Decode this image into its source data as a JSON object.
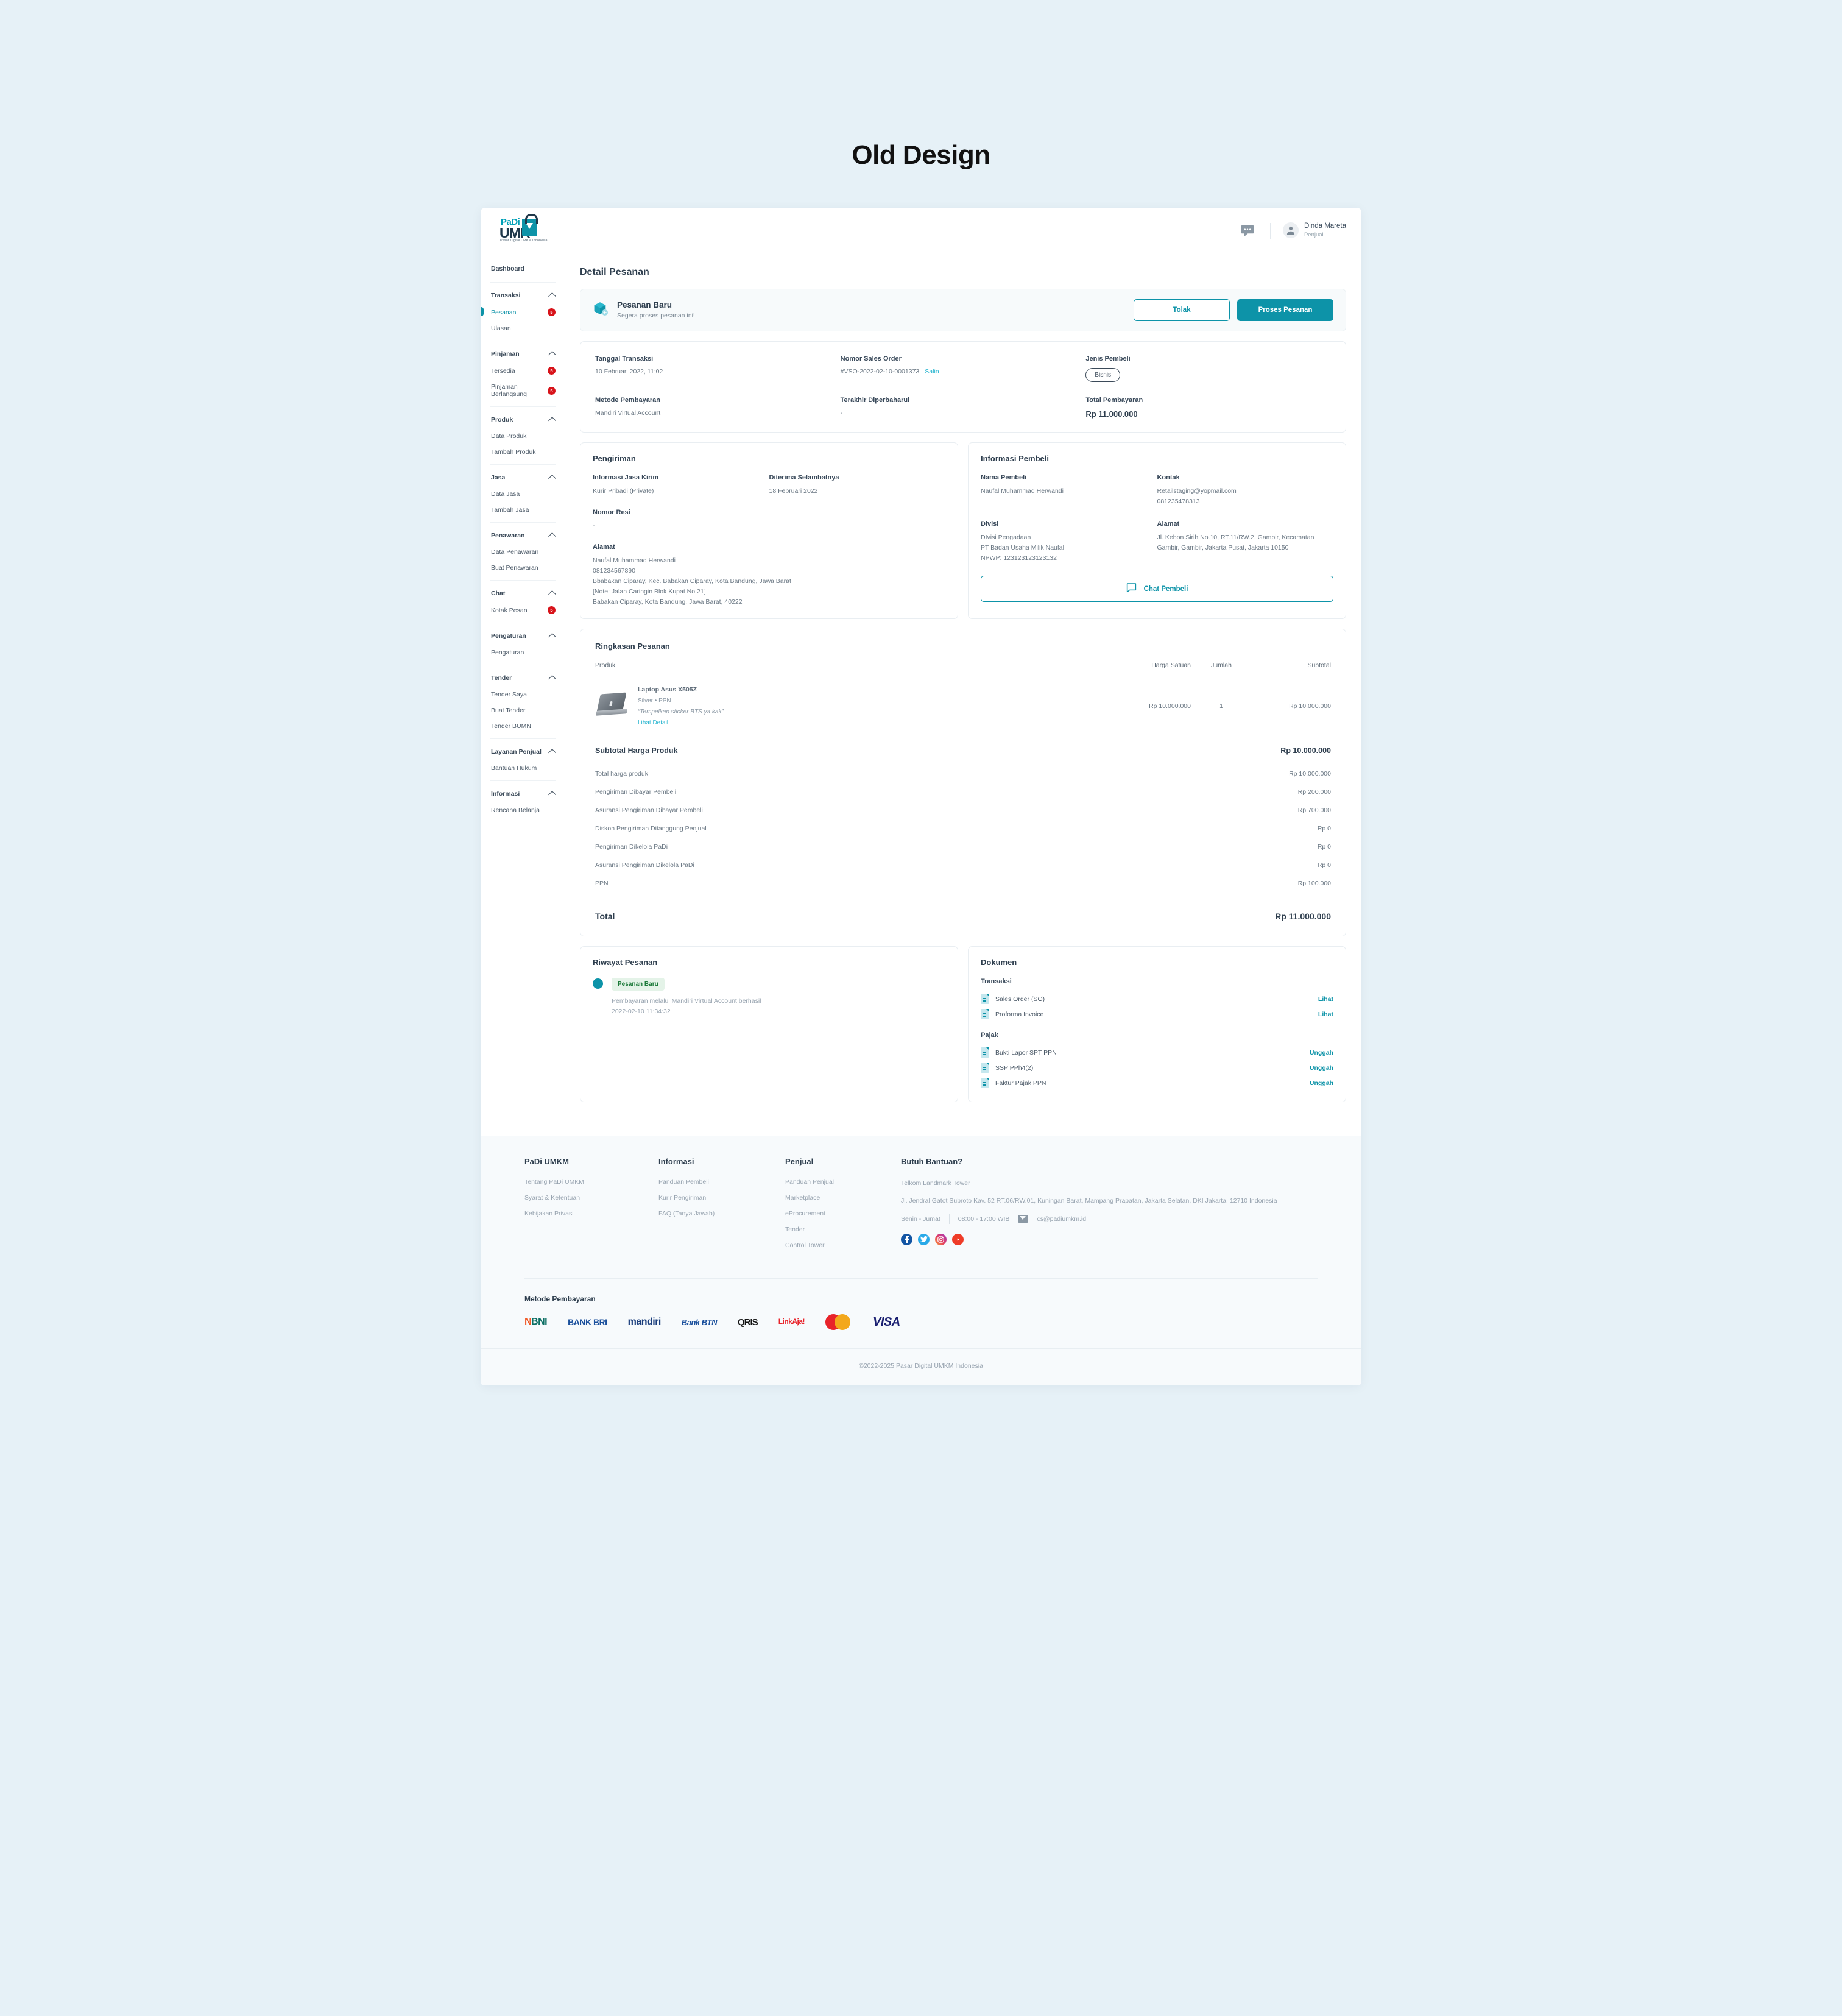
{
  "page": {
    "title": "Old Design"
  },
  "topbar": {
    "logo": {
      "padi": "PaDi",
      "umk": "UMK",
      "tagline": "Pasar Digital UMKM Indonesia"
    },
    "user": {
      "name": "Dinda Mareta",
      "role": "Penjual"
    }
  },
  "sidebar": {
    "dashboard": "Dashboard",
    "groups": [
      {
        "label": "Transaksi",
        "items": [
          {
            "label": "Pesanan",
            "badge": "5",
            "active": true
          },
          {
            "label": "Ulasan",
            "badge": "",
            "active": false
          }
        ]
      },
      {
        "label": "Pinjaman",
        "items": [
          {
            "label": "Tersedia",
            "badge": "5",
            "active": false
          },
          {
            "label": "Pinjaman Berlangsung",
            "badge": "5",
            "active": false
          }
        ]
      },
      {
        "label": "Produk",
        "items": [
          {
            "label": "Data Produk",
            "badge": "",
            "active": false
          },
          {
            "label": "Tambah Produk",
            "badge": "",
            "active": false
          }
        ]
      },
      {
        "label": "Jasa",
        "items": [
          {
            "label": "Data Jasa",
            "badge": "",
            "active": false
          },
          {
            "label": "Tambah Jasa",
            "badge": "",
            "active": false
          }
        ]
      },
      {
        "label": "Penawaran",
        "items": [
          {
            "label": "Data Penawaran",
            "badge": "",
            "active": false
          },
          {
            "label": "Buat Penawaran",
            "badge": "",
            "active": false
          }
        ]
      },
      {
        "label": "Chat",
        "items": [
          {
            "label": "Kotak Pesan",
            "badge": "5",
            "active": false
          }
        ]
      },
      {
        "label": "Pengaturan",
        "items": [
          {
            "label": "Pengaturan",
            "badge": "",
            "active": false
          }
        ]
      },
      {
        "label": "Tender",
        "items": [
          {
            "label": "Tender Saya",
            "badge": "",
            "active": false
          },
          {
            "label": "Buat Tender",
            "badge": "",
            "active": false
          },
          {
            "label": "Tender BUMN",
            "badge": "",
            "active": false
          }
        ]
      },
      {
        "label": "Layanan Penjual",
        "items": [
          {
            "label": "Bantuan Hukum",
            "badge": "",
            "active": false
          }
        ]
      },
      {
        "label": "Informasi",
        "items": [
          {
            "label": "Rencana Belanja",
            "badge": "",
            "active": false
          }
        ]
      }
    ]
  },
  "main": {
    "title": "Detail Pesanan",
    "status": {
      "title": "Pesanan Baru",
      "subtitle": "Segera proses pesanan ini!",
      "reject_label": "Tolak",
      "process_label": "Proses Pesanan"
    },
    "info": [
      {
        "label": "Tanggal Transaksi",
        "value": "10 Februari 2022, 11:02"
      },
      {
        "label": "Nomor Sales Order",
        "value": "#VSO-2022-02-10-0001373",
        "action": "Salin"
      },
      {
        "label": "Jenis Pembeli",
        "value": "Bisnis",
        "pill": true
      },
      {
        "label": "Metode Pembayaran",
        "value": "Mandiri Virtual Account"
      },
      {
        "label": "Terakhir Diperbaharui",
        "value": "-"
      },
      {
        "label": "Total Pembayaran",
        "value": "Rp 11.000.000",
        "strong": true
      }
    ],
    "shipping": {
      "title": "Pengiriman",
      "courier_label": "Informasi Jasa Kirim",
      "courier_value": "Kurir Pribadi (Private)",
      "eta_label": "Diterima Selambatnya",
      "eta_value": "18 Februari 2022",
      "resi_label": "Nomor Resi",
      "resi_value": "-",
      "address_label": "Alamat",
      "address_value": "Naufal Muhammad Herwandi\n081234567890\nBbabakan Ciparay, Kec. Babakan Ciparay, Kota Bandung, Jawa Barat\n[Note: Jalan Caringin Blok Kupat No.21]\nBabakan Ciparay, Kota Bandung, Jawa Barat, 40222"
    },
    "buyer": {
      "title": "Informasi Pembeli",
      "name_label": "Nama Pembeli",
      "name_value": "Naufal Muhammad Herwandi",
      "contact_label": "Kontak",
      "contact_value": "Retailstaging@yopmail.com\n081235478313",
      "division_label": "Divisi",
      "division_value": "DIvisi Pengadaan\nPT Badan Usaha Milik Naufal\nNPWP: 123123123123132",
      "address_label": "Alamat",
      "address_value": "Jl. Kebon Sirih No.10, RT.11/RW.2, Gambir, Kecamatan Gambir, Gambir, Jakarta Pusat, Jakarta 10150",
      "chat_label": "Chat Pembeli"
    },
    "summary": {
      "title": "Ringkasan Pesanan",
      "columns": [
        "Produk",
        "Harga Satuan",
        "Jumlah",
        "Subtotal"
      ],
      "rows": [
        {
          "name": "Laptop Asus X505Z",
          "attrs": "Silver  •  PPN",
          "note": "“Tempelkan sticker BTS ya kak”",
          "link": "Lihat Detail",
          "unit_price": "Rp 10.000.000",
          "qty": "1",
          "subtotal": "Rp 10.000.000"
        }
      ],
      "subtotal_label": "Subtotal Harga Produk",
      "subtotal_value": "Rp 10.000.000",
      "lines": [
        {
          "label": "Total harga produk",
          "value": "Rp 10.000.000"
        },
        {
          "label": "Pengiriman Dibayar Pembeli",
          "value": "Rp 200.000"
        },
        {
          "label": "Asuransi Pengiriman Dibayar Pembeli",
          "value": "Rp 700.000"
        },
        {
          "label": "Diskon Pengiriman Ditanggung Penjual",
          "value": "Rp 0"
        },
        {
          "label": "Pengiriman Dikelola PaDi",
          "value": "Rp 0"
        },
        {
          "label": "Asuransi Pengiriman Dikelola PaDi",
          "value": "Rp 0"
        },
        {
          "label": "PPN",
          "value": "Rp 100.000"
        }
      ],
      "total_label": "Total",
      "total_value": "Rp 11.000.000"
    },
    "history": {
      "title": "Riwayat Pesanan",
      "badge": "Pesanan Baru",
      "desc": "Pembayaran melalui Mandiri Virtual Account berhasil",
      "time": "2022-02-10 11:34:32"
    },
    "documents": {
      "title": "Dokumen",
      "groups": [
        {
          "label": "Transaksi",
          "items": [
            {
              "name": "Sales Order (SO)",
              "action": "Lihat"
            },
            {
              "name": "Proforma Invoice",
              "action": "Lihat"
            }
          ]
        },
        {
          "label": "Pajak",
          "items": [
            {
              "name": "Bukti Lapor SPT PPN",
              "action": "Unggah"
            },
            {
              "name": "SSP PPh4(2)",
              "action": "Unggah"
            },
            {
              "name": "Faktur Pajak PPN",
              "action": "Unggah"
            }
          ]
        }
      ]
    }
  },
  "footer": {
    "columns": [
      {
        "title": "PaDi UMKM",
        "links": [
          "Tentang PaDi UMKM",
          "Syarat & Ketentuan",
          "Kebijakan Privasi"
        ]
      },
      {
        "title": "Informasi",
        "links": [
          "Panduan Pembeli",
          "Kurir Pengiriman",
          "FAQ (Tanya Jawab)"
        ]
      },
      {
        "title": "Penjual",
        "links": [
          "Panduan Penjual",
          "Marketplace",
          "eProcurement",
          "Tender",
          "Control Tower"
        ]
      }
    ],
    "help": {
      "title": "Butuh Bantuan?",
      "building": "Telkom Landmark Tower",
      "address": "Jl. Jendral Gatot Subroto Kav. 52 RT.06/RW.01, Kuningan Barat, Mampang Prapatan, Jakarta Selatan, DKI Jakarta, 12710 Indonesia",
      "days": "Senin - Jumat",
      "hours": "08:00 - 17:00 WIB",
      "email": "cs@padiumkm.id"
    },
    "payment": {
      "title": "Metode Pembayaran",
      "logos": [
        "BNI",
        "BANK BRI",
        "mandiri",
        "Bank BTN",
        "QRIS",
        "LinkAja!",
        "MasterCard",
        "VISA"
      ]
    },
    "copyright": "©2022-2025 Pasar Digital UMKM Indonesia"
  }
}
